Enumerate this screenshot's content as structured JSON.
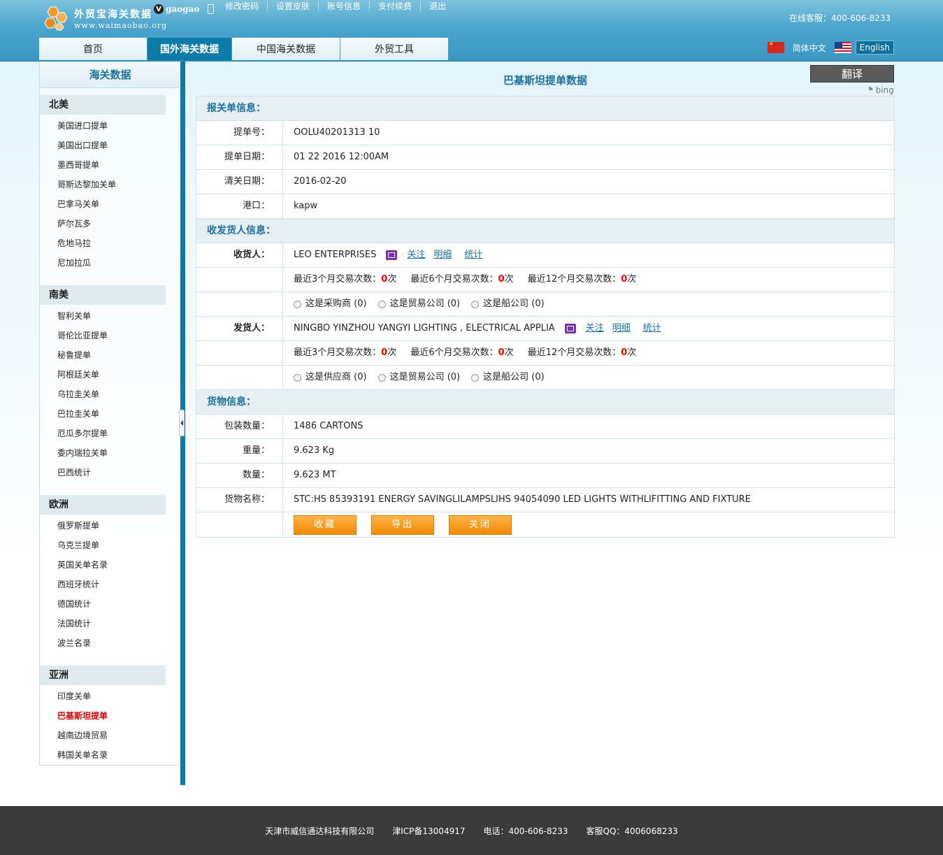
{
  "header": {
    "logo_title": "外贸宝海关数据",
    "logo_url": "www.waimaobao.org",
    "username": "gaogao",
    "links": [
      "修改密码",
      "设置皮肤",
      "账号信息",
      "支付续费",
      "退出"
    ],
    "hotline": "在线客服：400-606-8233",
    "nav": [
      "首页",
      "国外海关数据",
      "中国海关数据",
      "外贸工具"
    ],
    "lang_cn": "简体中文",
    "lang_en": "English"
  },
  "sidebar": {
    "title": "海关数据",
    "regions": [
      {
        "name": "北美",
        "items": [
          "美国进口提单",
          "美国出口提单",
          "墨西哥提单",
          "哥斯达黎加关单",
          "巴拿马关单",
          "萨尔瓦多",
          "危地马拉",
          "尼加拉瓜"
        ]
      },
      {
        "name": "南美",
        "items": [
          "智利关单",
          "哥伦比亚提单",
          "秘鲁提单",
          "阿根廷关单",
          "乌拉圭关单",
          "巴拉圭关单",
          "厄瓜多尔提单",
          "委内瑞拉关单",
          "巴西统计"
        ]
      },
      {
        "name": "欧洲",
        "items": [
          "俄罗斯提单",
          "乌克兰提单",
          "英国关单名录",
          "西班牙统计",
          "德国统计",
          "法国统计",
          "波兰名录"
        ]
      },
      {
        "name": "亚洲",
        "items": [
          "印度关单",
          "巴基斯坦提单",
          "越南边境贸易",
          "韩国关单名录"
        ]
      }
    ],
    "current": "巴基斯坦提单"
  },
  "main": {
    "title": "巴基斯坦提单数据",
    "translate": "翻译",
    "bing": "bing",
    "sections": {
      "declaration": "报关单信息：",
      "parties": "收发货人信息：",
      "goods": "货物信息："
    },
    "bill_no_label": "提单号：",
    "bill_no": "OOLU40201313 10",
    "bill_date_label": "提单日期：",
    "bill_date": "01 22 2016 12:00AM",
    "clear_date_label": "清关日期：",
    "clear_date": "2016-02-20",
    "port_label": "港口：",
    "port": "kapw",
    "consignee_label": "收货人：",
    "consignee": "LEO ENTERPRISES",
    "shipper_label": "发货人：",
    "shipper": "NINGBO YINZHOU YANGYI LIGHTING , ELECTRICAL APPLIA",
    "actions": [
      "关注",
      "明细",
      "统计"
    ],
    "stats": [
      {
        "label": "最近3个月交易次数：",
        "num": "0",
        "unit": "次"
      },
      {
        "label": "最近6个月交易次数：",
        "num": "0",
        "unit": "次"
      },
      {
        "label": "最近12个月交易次数：",
        "num": "0",
        "unit": "次"
      }
    ],
    "consignee_radios": [
      "这是采购商 (0)",
      "这是贸易公司 (0)",
      "这是船公司 (0)"
    ],
    "shipper_radios": [
      "这是供应商 (0)",
      "这是贸易公司 (0)",
      "这是船公司 (0)"
    ],
    "pkg_label": "包装数量：",
    "pkg": "1486 CARTONS",
    "weight_label": "重量：",
    "weight": "9.623 Kg",
    "qty_label": "数量：",
    "qty": "9.623 MT",
    "goods_label": "货物名称：",
    "goods": "STC:HS 85393191 ENERGY SAVINGLILAMPSLIHS 94054090 LED LIGHTS WITHLIFITTING AND FIXTURE",
    "buttons": [
      "收藏",
      "导出",
      "关闭"
    ]
  },
  "footer": [
    "天津市威信通达科技有限公司",
    "津ICP备13004917",
    "电话：400-606-8233",
    "客服QQ：4006068233"
  ]
}
